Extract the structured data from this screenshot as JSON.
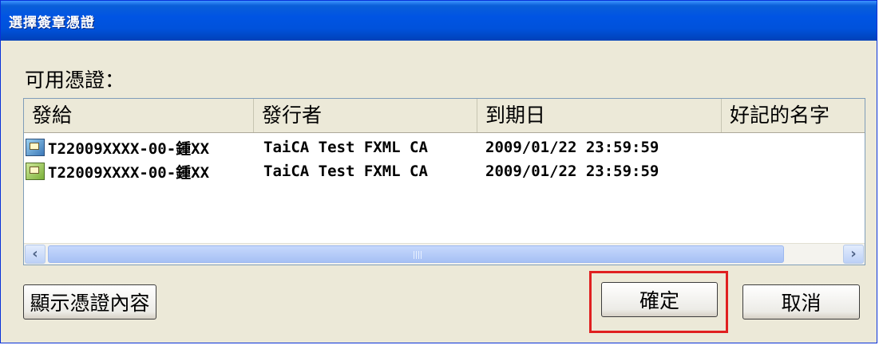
{
  "window": {
    "title": "選擇簽章憑證"
  },
  "list": {
    "group_label": "可用憑證：",
    "columns": [
      "發給",
      "發行者",
      "到期日",
      "好記的名字"
    ],
    "rows": [
      {
        "icon": "certificate-icon",
        "issued_to": "T22009XXXX-00-鍾XX",
        "issuer": "TaiCA Test FXML CA",
        "expires": "2009/01/22 23:59:59",
        "friendly_name": ""
      },
      {
        "icon": "certificate-icon",
        "issued_to": "T22009XXXX-00-鍾XX",
        "issuer": "TaiCA Test FXML CA",
        "expires": "2009/01/22 23:59:59",
        "friendly_name": ""
      }
    ],
    "scroll": {
      "left_arrow": "‹",
      "right_arrow": "›"
    }
  },
  "buttons": {
    "show_cert": "顯示憑證內容",
    "ok": "確定",
    "cancel": "取消"
  },
  "colors": {
    "titlebar": "#0054e3",
    "highlight": "#e02020",
    "dialog_bg": "#ece9d8"
  }
}
